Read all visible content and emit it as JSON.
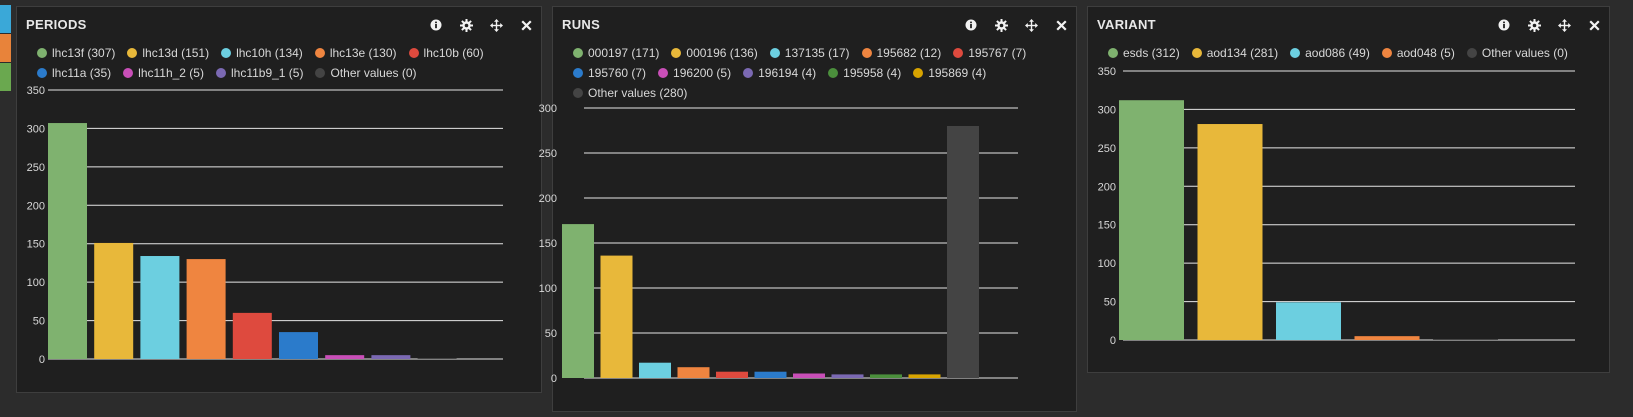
{
  "side_tabs": [
    "#3aa8d8",
    "#e8833a",
    "#6aa84f"
  ],
  "panels": [
    {
      "title": "PERIODS"
    },
    {
      "title": "RUNS"
    },
    {
      "title": "VARIANT"
    }
  ],
  "toolbar": {
    "info_icon": "info-icon",
    "settings_icon": "gear-icon",
    "move_icon": "move-icon",
    "close_icon": "close-icon"
  },
  "chart_data": [
    {
      "type": "bar",
      "title": "PERIODS",
      "ylim": [
        0,
        350
      ],
      "yticks": [
        "0",
        "50",
        "100",
        "150",
        "200",
        "250",
        "300",
        "350"
      ],
      "grid": true,
      "legend_position": "top",
      "categories": [
        "lhc13f (307)",
        "lhc13d (151)",
        "lhc10h (134)",
        "lhc13e (130)",
        "lhc10b (60)",
        "lhc11a (35)",
        "lhc11h_2 (5)",
        "lhc11b9_1 (5)",
        "Other values (0)"
      ],
      "values": [
        307,
        151,
        134,
        130,
        60,
        35,
        5,
        5,
        0
      ],
      "colors": [
        "#7fb26f",
        "#e8b83a",
        "#6ccfe0",
        "#ef8540",
        "#de4a3e",
        "#2b7bcb",
        "#c94fb8",
        "#7b69b3",
        "#444444"
      ]
    },
    {
      "type": "bar",
      "title": "RUNS",
      "ylim": [
        0,
        300
      ],
      "yticks": [
        "0",
        "50",
        "100",
        "150",
        "200",
        "250",
        "300"
      ],
      "grid": true,
      "legend_position": "top",
      "categories": [
        "000197 (171)",
        "000196 (136)",
        "137135 (17)",
        "195682 (12)",
        "195767 (7)",
        "195760 (7)",
        "196200 (5)",
        "196194 (4)",
        "195958 (4)",
        "195869 (4)",
        "Other values (280)"
      ],
      "values": [
        171,
        136,
        17,
        12,
        7,
        7,
        5,
        4,
        4,
        4,
        280
      ],
      "colors": [
        "#7fb26f",
        "#e8b83a",
        "#6ccfe0",
        "#ef8540",
        "#de4a3e",
        "#2b7bcb",
        "#c94fb8",
        "#7b69b3",
        "#4b8f3c",
        "#d8a400",
        "#444444"
      ]
    },
    {
      "type": "bar",
      "title": "VARIANT",
      "ylim": [
        0,
        350
      ],
      "yticks": [
        "0",
        "50",
        "100",
        "150",
        "200",
        "250",
        "300",
        "350"
      ],
      "grid": true,
      "legend_position": "top",
      "categories": [
        "esds (312)",
        "aod134 (281)",
        "aod086 (49)",
        "aod048 (5)",
        "Other values (0)"
      ],
      "values": [
        312,
        281,
        49,
        5,
        0
      ],
      "colors": [
        "#7fb26f",
        "#e8b83a",
        "#6ccfe0",
        "#ef8540",
        "#444444"
      ]
    }
  ]
}
